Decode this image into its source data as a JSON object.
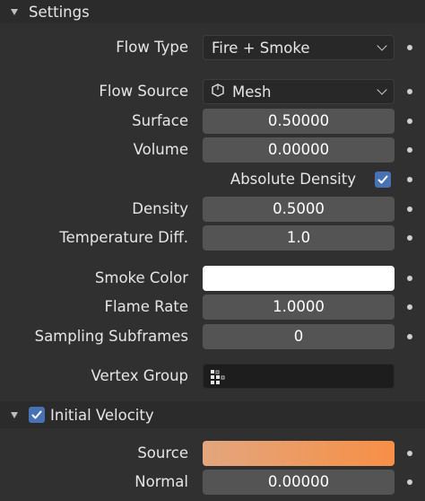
{
  "settings_header": {
    "title": "Settings"
  },
  "flow_type": {
    "label": "Flow Type",
    "value": "Fire + Smoke"
  },
  "flow_source": {
    "label": "Flow Source",
    "value": "Mesh"
  },
  "surface": {
    "label": "Surface",
    "value": "0.50000"
  },
  "volume": {
    "label": "Volume",
    "value": "0.00000"
  },
  "absolute_density": {
    "label": "Absolute Density",
    "checked": true
  },
  "density": {
    "label": "Density",
    "value": "0.5000"
  },
  "temperature_diff": {
    "label": "Temperature Diff.",
    "value": "1.0"
  },
  "smoke_color": {
    "label": "Smoke Color",
    "color": "#ffffff"
  },
  "flame_rate": {
    "label": "Flame Rate",
    "value": "1.0000"
  },
  "sampling_subframes": {
    "label": "Sampling Subframes",
    "value": "0"
  },
  "vertex_group": {
    "label": "Vertex Group",
    "value": ""
  },
  "initial_velocity_header": {
    "title": "Initial Velocity",
    "checked": true
  },
  "source": {
    "label": "Source",
    "gradient_start": "#e3a67e",
    "gradient_end": "#f78f45"
  },
  "normal": {
    "label": "Normal",
    "value": "0.00000"
  },
  "colors": {
    "accent": "#4772b3",
    "panel": "#303030",
    "header": "#2b2b2b",
    "field": "#545454"
  }
}
